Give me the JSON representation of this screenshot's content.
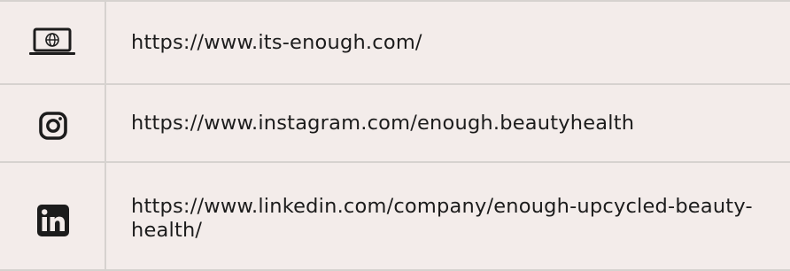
{
  "links": [
    {
      "icon": "website-laptop-globe-icon",
      "url": "https://www.its-enough.com/"
    },
    {
      "icon": "instagram-icon",
      "url": "https://www.instagram.com/enough.beautyhealth"
    },
    {
      "icon": "linkedin-icon",
      "url": "https://www.linkedin.com/company/enough-upcycled-beauty-health/"
    }
  ],
  "colors": {
    "background": "#f3ecea",
    "divider": "#d6d2cf",
    "text": "#1c1c1c"
  }
}
